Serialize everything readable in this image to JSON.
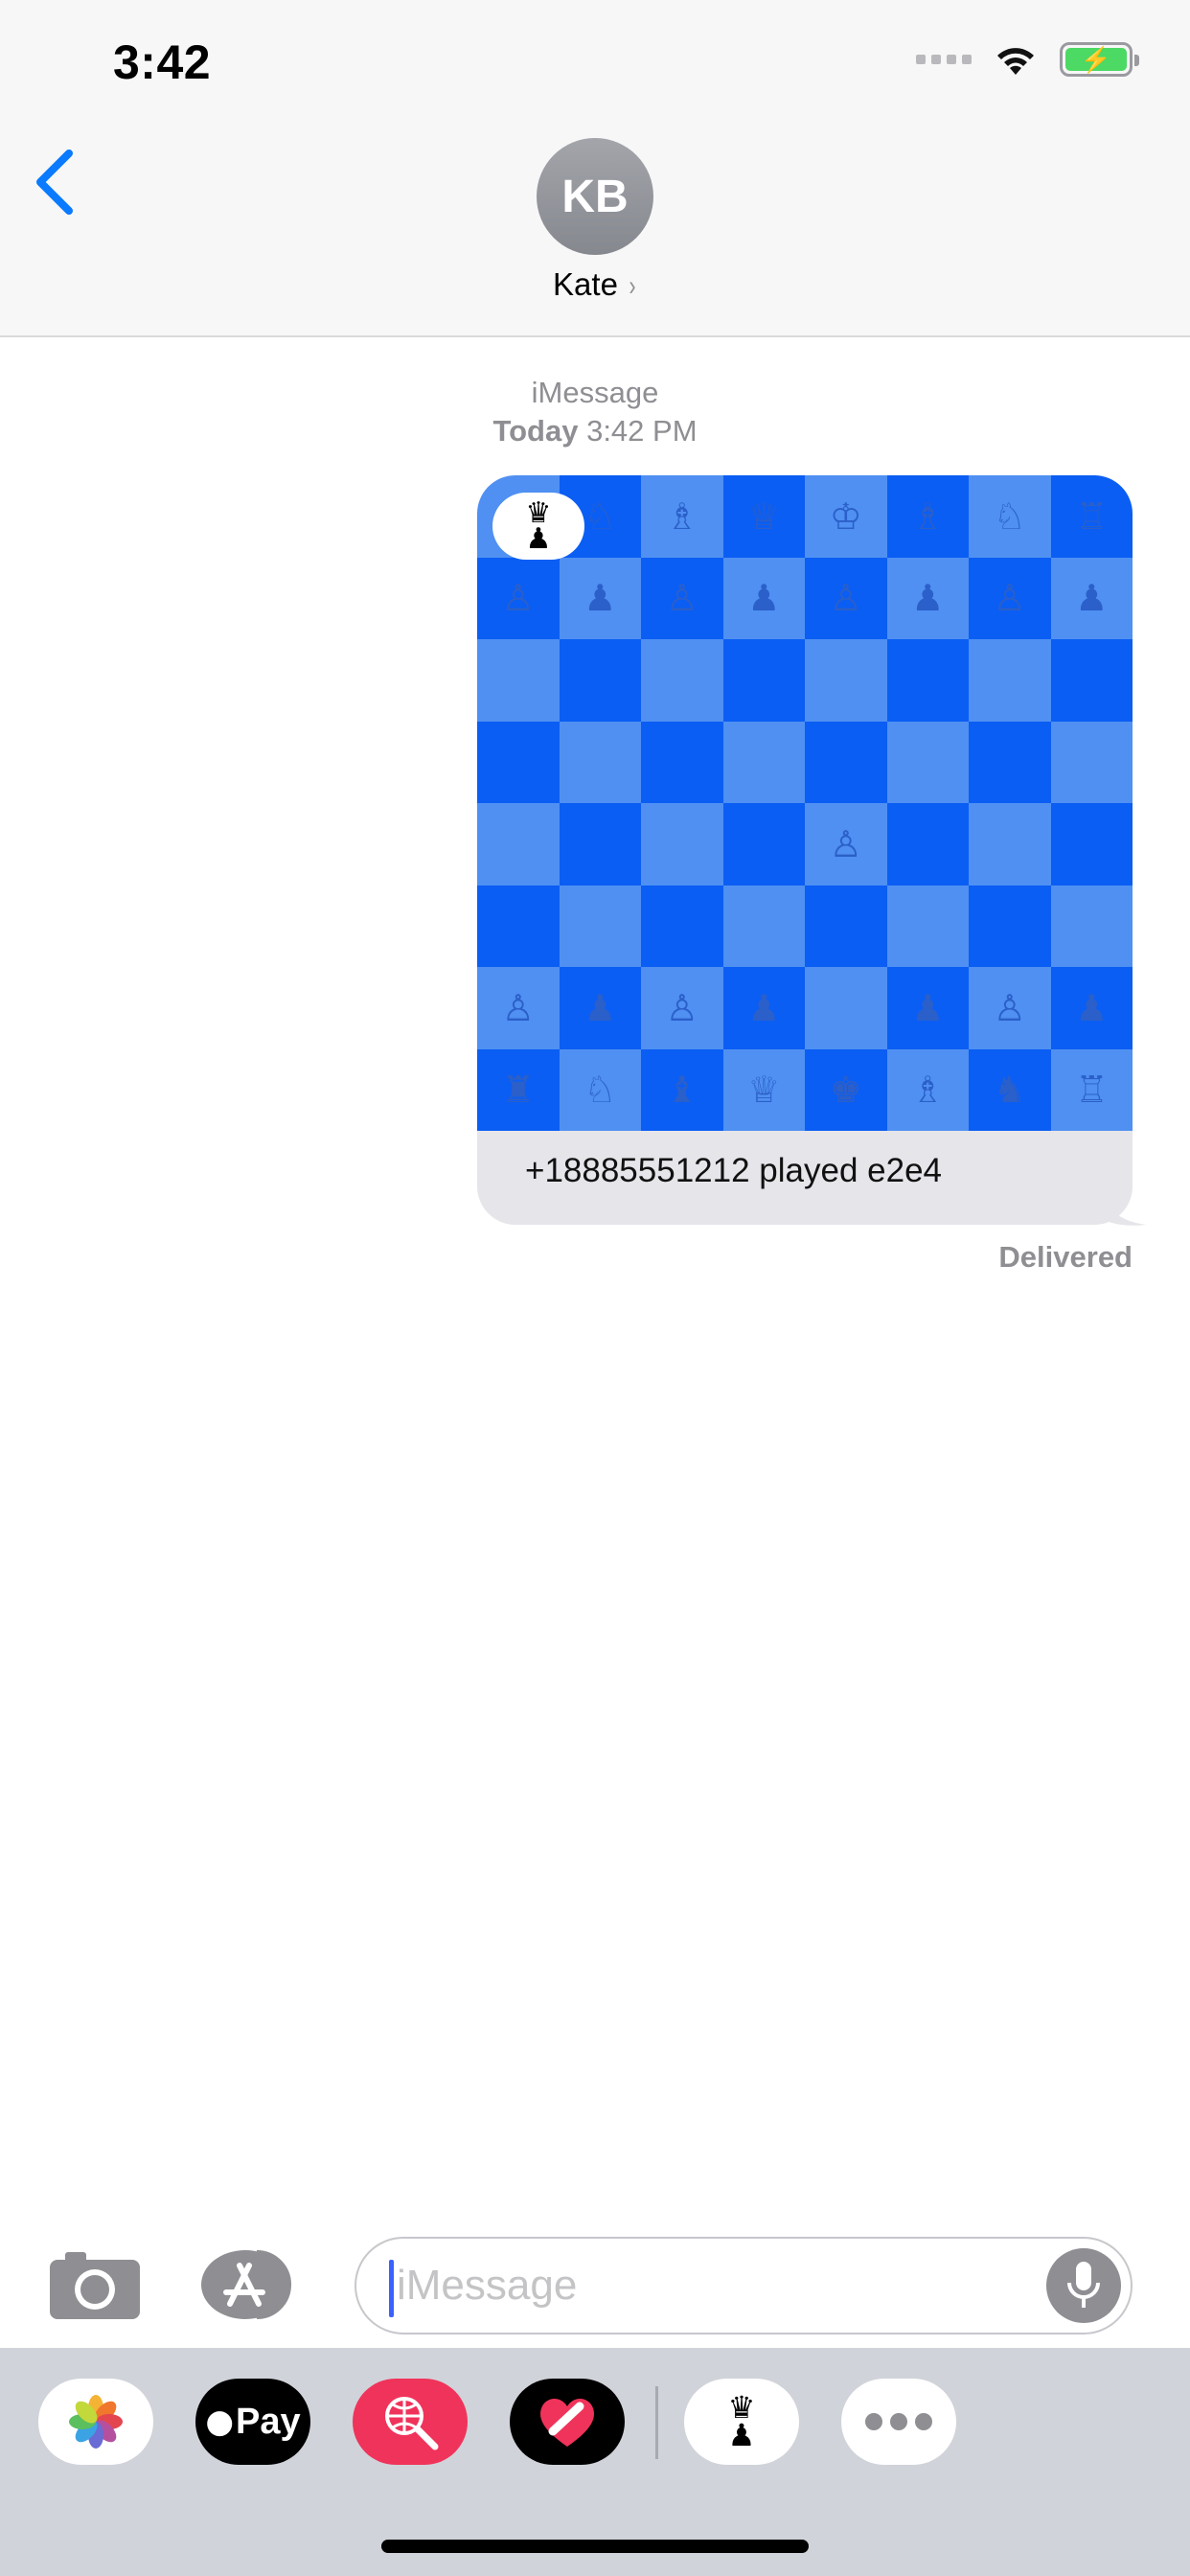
{
  "status_bar": {
    "time": "3:42"
  },
  "header": {
    "avatar_initials": "KB",
    "contact_name": "Kate"
  },
  "conversation": {
    "service": "iMessage",
    "day": "Today",
    "time": "3:42 PM",
    "message": {
      "caption": "+18885551212 played e2e4",
      "board": [
        [
          "♖",
          "♘",
          "♗",
          "♕",
          "♔",
          "♗",
          "♘",
          "♖"
        ],
        [
          "♙",
          "♟",
          "♙",
          "♟",
          "♙",
          "♟",
          "♙",
          "♟"
        ],
        [
          "",
          "",
          "",
          "",
          "",
          "",
          "",
          ""
        ],
        [
          "",
          "",
          "",
          "",
          "",
          "",
          "",
          ""
        ],
        [
          "",
          "",
          "",
          "",
          "♙",
          "",
          "",
          ""
        ],
        [
          "",
          "",
          "",
          "",
          "",
          "",
          "",
          ""
        ],
        [
          "♙",
          "♟",
          "♙",
          "♟",
          "",
          "♟",
          "♙",
          "♟"
        ],
        [
          "♜",
          "♘",
          "♝",
          "♕",
          "♚",
          "♗",
          "♞",
          "♖"
        ]
      ]
    },
    "status": "Delivered"
  },
  "composer": {
    "placeholder": "iMessage"
  },
  "drawer": {
    "apps": [
      "Photos",
      "Apple Pay",
      "Search Images",
      "Digital Touch",
      "Chess",
      "More"
    ],
    "apple_pay_label": "Pay"
  },
  "colors": {
    "accent": "#0a7aff",
    "board_light": "#4f90f2",
    "board_dark": "#0b5ef3"
  }
}
